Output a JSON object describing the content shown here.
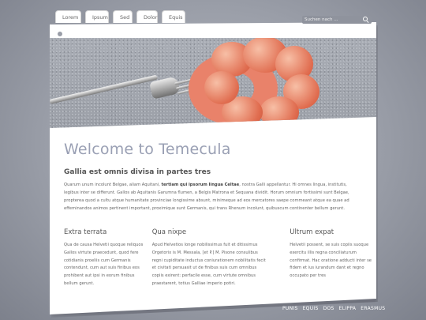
{
  "nav": {
    "tabs": [
      "Lorem",
      "Ipsum",
      "Sed",
      "Dolor",
      "Equis"
    ]
  },
  "search": {
    "placeholder": "Suchen nach ..."
  },
  "hero": {
    "image_description": "shrimp-on-fork"
  },
  "main": {
    "title": "Welcome to Temecula",
    "subtitle": "Gallia est omnis divisa in partes tres",
    "intro_before": "Quarum unum incolunt Belgae, aliam Aquitani, ",
    "intro_bold": "tertiam qui ipsorum lingua Celtae",
    "intro_after": ", nostra Galli appellantur. Hi omnes lingua, institutis, legibus inter se differunt. Gallos ab Aquitanis Garumna flumen, a Belgis Matrona et Sequana dividit. Horum omnium fortissimi sunt Belgae, propterea quod a cultu atque humanitate provinciae longissime absunt, minimeque ad eos mercatores saepe commeant atque ea quae ad effeminandos animos pertinent important, proximique sunt Germanis, qui trans Rhenum incolunt, quibuscum continenter bellum gerunt."
  },
  "columns": [
    {
      "heading": "Extra terrata",
      "text": "Qua de causa Helvetii quoque reliquos Gallos virtute praecedunt, quod fere cotidianis proeliis cum Germanis contendunt, cum aut suis finibus eos prohibent aut ipsi in eorum finibus bellum gerunt."
    },
    {
      "heading": "Qua nixpe",
      "text": "Apud Helvetios longe nobilissimus fuit et ditissimus Orgetorix is M. Messala, [et P.] M. Pisone consulibus regni cupiditate inductus coniurationem nobilitatis fecit et civitati persuasit ut de finibus suis cum omnibus copiis exirent: perfacile esse, cum virtute omnibus praestarent, totius Galliae imperio potiri."
    },
    {
      "heading": "Ultrum expat",
      "text": "Helvetii possent, se suis copiis suoque exercitu illis regna conciliaturum confirmat. Hac oratione adducti inter se fidem et ius iurandum dant et regno occupato per tres"
    }
  ],
  "footer": {
    "links": [
      "PUNIS",
      "EQUIS",
      "DOS",
      "ELIPPA",
      "ERASMUS"
    ]
  }
}
